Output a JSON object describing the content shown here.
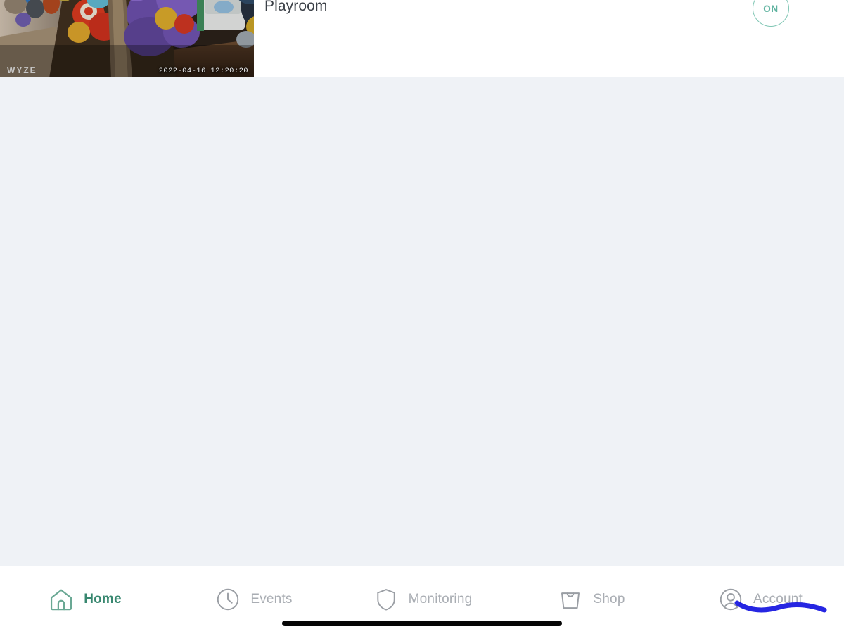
{
  "app": {
    "background_color": "#eff2f6",
    "card_background": "#ffffff",
    "accent_color": "#38876f",
    "inactive_color": "#a9adb3"
  },
  "device_card": {
    "name": "Playroom",
    "thumbnail": {
      "watermark": "WYZE",
      "timestamp": "2022-04-16 12:20:20",
      "icon": "camera-snapshot"
    },
    "power_toggle": {
      "label": "ON",
      "state": "on",
      "color": "#5fb3a0"
    }
  },
  "tabbar": {
    "items": [
      {
        "label": "Home",
        "icon": "home-icon",
        "active": true
      },
      {
        "label": "Events",
        "icon": "clock-icon",
        "active": false
      },
      {
        "label": "Monitoring",
        "icon": "shield-icon",
        "active": false
      },
      {
        "label": "Shop",
        "icon": "shopping-bag-icon",
        "active": false
      },
      {
        "label": "Account",
        "icon": "user-circle-icon",
        "active": false
      }
    ]
  },
  "annotation": {
    "type": "hand-drawn-underline",
    "target": "Account",
    "color": "#1a1ae0"
  },
  "system": {
    "home_indicator": "home-indicator-bar"
  }
}
